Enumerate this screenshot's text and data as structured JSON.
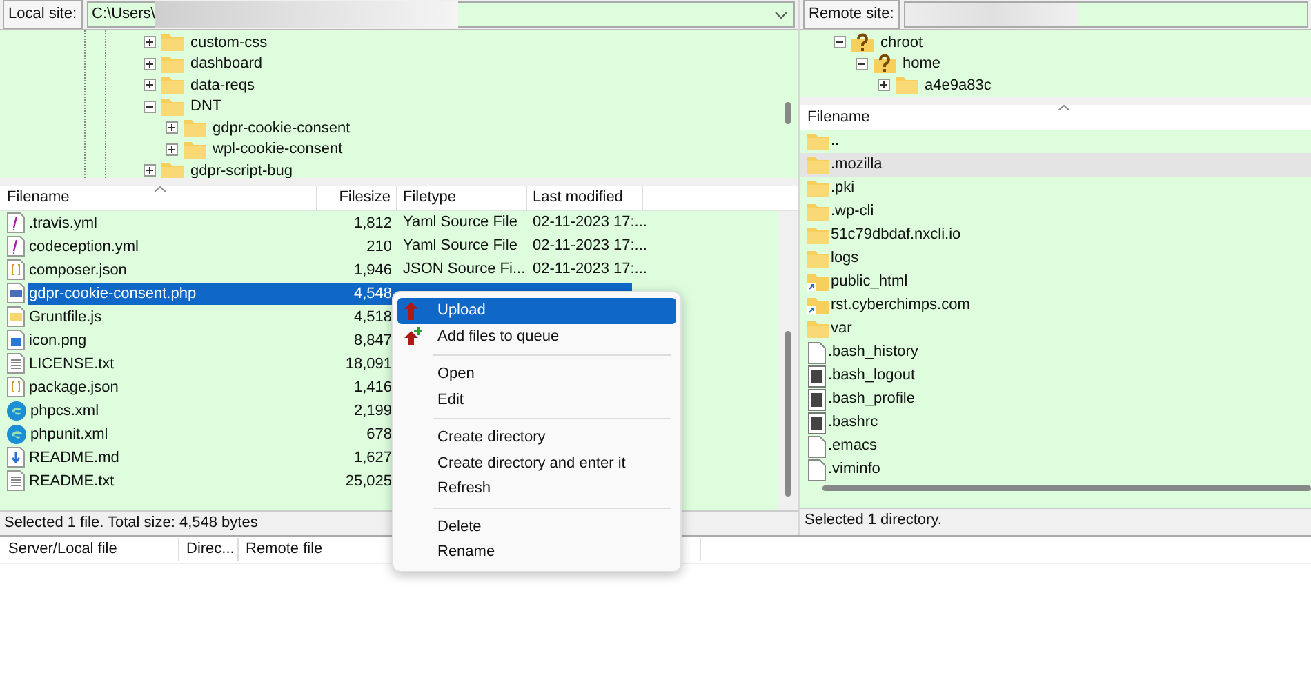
{
  "local_site": {
    "label": "Local site:",
    "path": "C:\\Users\\"
  },
  "local_tree": [
    {
      "name": "custom-css",
      "kind": "folder",
      "expanded": false
    },
    {
      "name": "dashboard",
      "kind": "folder",
      "expanded": false
    },
    {
      "name": "data-reqs",
      "kind": "folder",
      "expanded": false
    },
    {
      "name": "DNT",
      "kind": "folder",
      "expanded": true,
      "children": [
        {
          "name": "gdpr-cookie-consent",
          "kind": "folder",
          "expanded": false
        },
        {
          "name": "wpl-cookie-consent",
          "kind": "folder",
          "expanded": false
        }
      ]
    },
    {
      "name": "gdpr-script-bug",
      "kind": "folder",
      "expanded": false
    }
  ],
  "local_files": {
    "columns": [
      "Filename",
      "Filesize",
      "Filetype",
      "Last modified"
    ],
    "rows": [
      {
        "name": ".travis.yml",
        "kind": "yaml",
        "size": "1,812",
        "type": "Yaml Source File",
        "modified": "02-11-2023 17:...",
        "selected": false
      },
      {
        "name": "codeception.yml",
        "kind": "yaml",
        "size": "210",
        "type": "Yaml Source File",
        "modified": "02-11-2023 17:...",
        "selected": false
      },
      {
        "name": "composer.json",
        "kind": "json",
        "size": "1,946",
        "type": "JSON Source Fi...",
        "modified": "02-11-2023 17:...",
        "selected": false
      },
      {
        "name": "gdpr-cookie-consent.php",
        "kind": "php",
        "size": "4,548",
        "selected": true
      },
      {
        "name": "Gruntfile.js",
        "kind": "js",
        "size": "4,518",
        "selected": false
      },
      {
        "name": "icon.png",
        "kind": "image",
        "size": "8,847",
        "selected": false
      },
      {
        "name": "LICENSE.txt",
        "kind": "text",
        "size": "18,091",
        "selected": false
      },
      {
        "name": "package.json",
        "kind": "json",
        "size": "1,416",
        "selected": false
      },
      {
        "name": "phpcs.xml",
        "kind": "browser",
        "size": "2,199",
        "selected": false
      },
      {
        "name": "phpunit.xml",
        "kind": "browser",
        "size": "678",
        "selected": false
      },
      {
        "name": "README.md",
        "kind": "markdown",
        "size": "1,627",
        "selected": false
      },
      {
        "name": "README.txt",
        "kind": "text",
        "size": "25,025",
        "selected": false
      }
    ]
  },
  "local_status": "Selected 1 file. Total size: 4,548 bytes",
  "remote_site": {
    "label": "Remote site:"
  },
  "remote_tree": [
    {
      "name": "chroot",
      "kind": "unknown",
      "expanded": true,
      "children": [
        {
          "name": "home",
          "kind": "unknown",
          "expanded": true,
          "children": [
            {
              "name": "a4e9a83c",
              "kind": "folder",
              "expanded": false
            }
          ]
        }
      ]
    }
  ],
  "remote_files": {
    "columns": [
      "Filename"
    ],
    "rows": [
      {
        "name": "..",
        "kind": "folder",
        "selected": false
      },
      {
        "name": ".mozilla",
        "kind": "folder",
        "selected": true
      },
      {
        "name": ".pki",
        "kind": "folder",
        "selected": false
      },
      {
        "name": ".wp-cli",
        "kind": "folder",
        "selected": false
      },
      {
        "name": "51c79dbdaf.nxcli.io",
        "kind": "folder",
        "selected": false
      },
      {
        "name": "logs",
        "kind": "folder",
        "selected": false
      },
      {
        "name": "public_html",
        "kind": "link",
        "selected": false
      },
      {
        "name": "rst.cyberchimps.com",
        "kind": "link",
        "selected": false
      },
      {
        "name": "var",
        "kind": "folder",
        "selected": false
      },
      {
        "name": ".bash_history",
        "kind": "file",
        "selected": false
      },
      {
        "name": ".bash_logout",
        "kind": "script",
        "selected": false
      },
      {
        "name": ".bash_profile",
        "kind": "script",
        "selected": false
      },
      {
        "name": ".bashrc",
        "kind": "script",
        "selected": false
      },
      {
        "name": ".emacs",
        "kind": "file",
        "selected": false
      },
      {
        "name": ".viminfo",
        "kind": "file",
        "selected": false
      }
    ]
  },
  "remote_status": "Selected 1 directory.",
  "queue": {
    "columns": [
      "Server/Local file",
      "Direc...",
      "Remote file"
    ]
  },
  "context_menu": {
    "items": [
      {
        "kind": "upload",
        "label": "Upload",
        "selected": true
      },
      {
        "kind": "enqueue",
        "label": "Add files to queue",
        "selected": false
      },
      {
        "kind": "separator"
      },
      {
        "kind": "item",
        "label": "Open",
        "selected": false
      },
      {
        "kind": "item",
        "label": "Edit",
        "selected": false
      },
      {
        "kind": "separator"
      },
      {
        "kind": "item",
        "label": "Create directory",
        "selected": false
      },
      {
        "kind": "item",
        "label": "Create directory and enter it",
        "selected": false
      },
      {
        "kind": "item",
        "label": "Refresh",
        "selected": false
      },
      {
        "kind": "separator"
      },
      {
        "kind": "item",
        "label": "Delete",
        "selected": false
      },
      {
        "kind": "item",
        "label": "Rename",
        "selected": false
      }
    ]
  }
}
